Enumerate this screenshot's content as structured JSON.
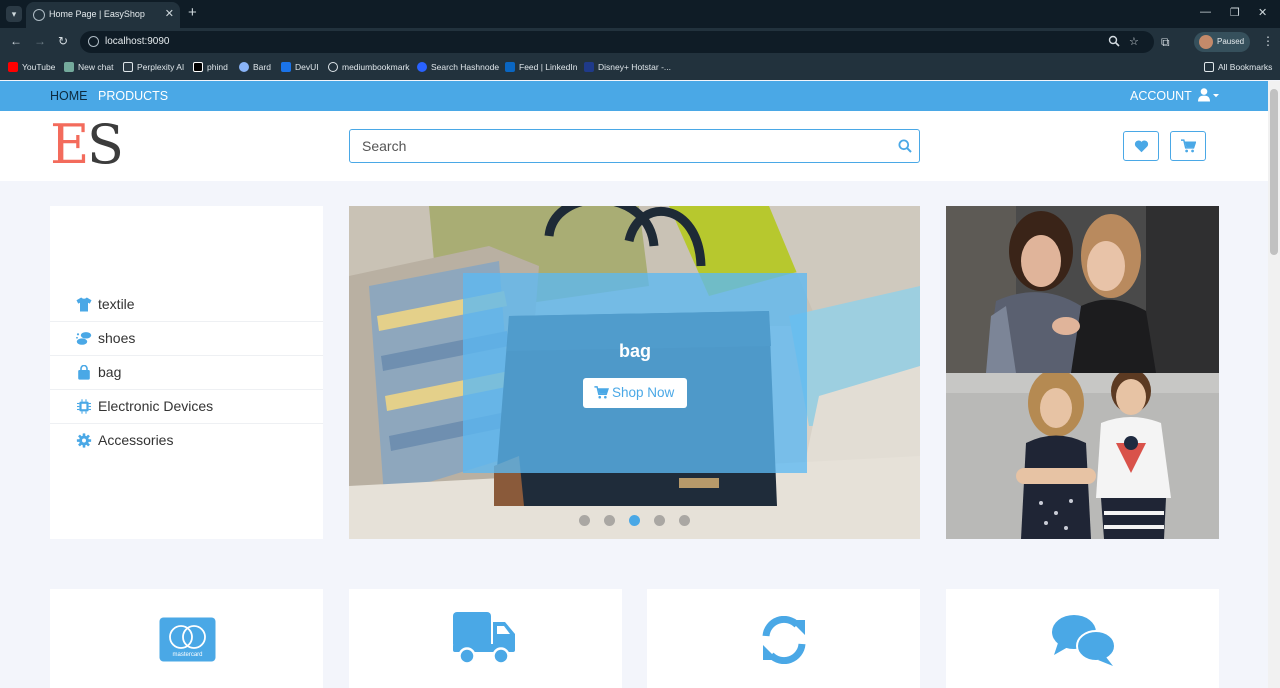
{
  "browser": {
    "tab_title": "Home Page | EasyShop",
    "url": "localhost:9090",
    "profile_label": "Paused",
    "all_bookmarks": "All Bookmarks",
    "bookmarks": [
      {
        "label": "YouTube",
        "color": "#ff0000"
      },
      {
        "label": "New chat",
        "color": "#74aa9c"
      },
      {
        "label": "Perplexity AI",
        "color": "#dfe6ea"
      },
      {
        "label": "phind",
        "color": "#ffffff"
      },
      {
        "label": "Bard",
        "color": "#8ab4f8"
      },
      {
        "label": "DevUI",
        "color": "#1a73e8"
      },
      {
        "label": "mediumbookmark",
        "color": "#dfe6ea"
      },
      {
        "label": "Search Hashnode",
        "color": "#2962ff"
      },
      {
        "label": "Feed | LinkedIn",
        "color": "#0a66c2"
      },
      {
        "label": "Disney+ Hotstar -...",
        "color": "#1f3a8a"
      }
    ]
  },
  "nav": {
    "home": "HOME",
    "products": "PRODUCTS",
    "account": "ACCOUNT"
  },
  "logo": {
    "first": "E",
    "second": "S"
  },
  "search": {
    "placeholder": "Search"
  },
  "categories": [
    {
      "label": "textile",
      "icon": "tshirt-icon"
    },
    {
      "label": "shoes",
      "icon": "shoe-icon"
    },
    {
      "label": "bag",
      "icon": "shopping-bag-icon"
    },
    {
      "label": "Electronic Devices",
      "icon": "microchip-icon"
    },
    {
      "label": "Accessories",
      "icon": "gear-icon"
    }
  ],
  "hero": {
    "title": "bag",
    "button_label": "Shop Now",
    "slide_count": 5,
    "active_slide": 3
  },
  "features": [
    {
      "icon": "mastercard-icon",
      "card_text": "mastercard"
    },
    {
      "icon": "delivery-truck-icon"
    },
    {
      "icon": "refresh-icon"
    },
    {
      "icon": "chat-bubbles-icon"
    }
  ],
  "colors": {
    "accent": "#4aa8e6",
    "logo_e": "#f36b5c",
    "logo_s": "#3c3c3c",
    "page_bg": "#f3f5fb"
  }
}
